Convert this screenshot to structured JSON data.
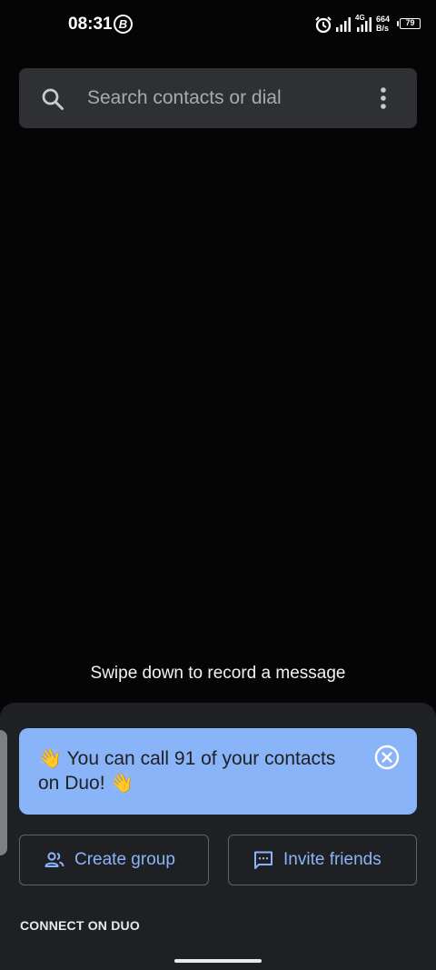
{
  "status_bar": {
    "time": "08:31",
    "badge_letter": "B",
    "network_type": "4G",
    "speed_value": "664",
    "speed_unit": "B/s",
    "battery": "79",
    "icons": [
      "alarm-icon",
      "signal-icon",
      "signal-icon",
      "battery-icon"
    ]
  },
  "search": {
    "placeholder": "Search contacts or dial",
    "icon": "search-icon",
    "menu_icon": "more-vert-icon"
  },
  "camera": {
    "hint": "Swipe down to record a message"
  },
  "promo": {
    "text": "👋 You can call 91 of your contacts on Duo! 👋",
    "close_icon": "close-circle-icon"
  },
  "actions": {
    "create_group": "Create group",
    "invite_friends": "Invite friends"
  },
  "section": {
    "title": "CONNECT ON DUO"
  },
  "colors": {
    "accent": "#8ab4f8",
    "surface": "#1f2023",
    "search_bg": "#2f3033"
  }
}
